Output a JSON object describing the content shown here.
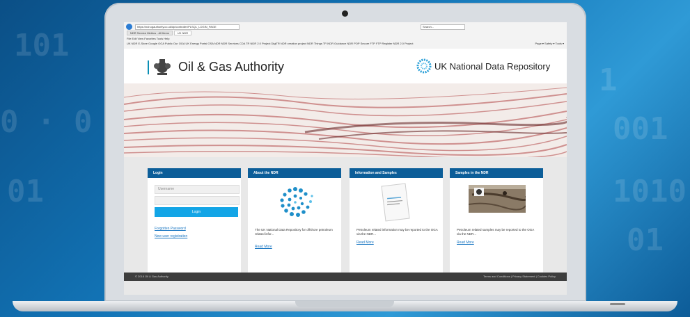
{
  "browser": {
    "url": "https://ndr.ogauthority.co.uk/dp/controller/PLSQL_LOGIN_PAGE",
    "search_placeholder": "Search...",
    "tabs": [
      {
        "label": "NDR Service Metrics - All Items"
      },
      {
        "label": "UK NDR"
      }
    ],
    "menu": "File  Edit  View  Favorites  Tools  Help",
    "favorites": "UK NDR  E-Store  Google  OGA Public  Our OGA  UK Energy Portal  OSA NDR  NDR Services  CDA TR  NDR 2.0 Project  DigiTR  NDR creation project  NDR Things  TP-NDR Guidance  NDR POP  Secure FTP  FTP Register  NDR 2.0 Project",
    "tools": "Page ▾  Safety ▾  Tools ▾"
  },
  "header": {
    "left_title": "Oil & Gas Authority",
    "right_title": "UK National Data Repository"
  },
  "login": {
    "heading": "Login",
    "username_placeholder": "Username",
    "button": "Login",
    "forgotten": "Forgotten Password",
    "register": "New user registration"
  },
  "cards": [
    {
      "heading": "About the NDR",
      "text": "The UK National Data Repository for offshore petroleum related infor...",
      "read_more": "Read More"
    },
    {
      "heading": "Information and Samples",
      "text": "Petroleum related information may be reported to the OGA via the NDR...",
      "read_more": "Read More"
    },
    {
      "heading": "Samples in the NDR",
      "text": "Petroleum related samples may be reported to the OGA via the NDR...",
      "read_more": "Read More"
    }
  ],
  "footer": {
    "left": "© 2018 Oil & Gas Authority",
    "right": "Terms and Conditions  |  Privacy Statement  |  Cookies Policy"
  },
  "colors": {
    "accent": "#0c5e99",
    "button": "#13a5e6",
    "background": "#1273b5"
  }
}
